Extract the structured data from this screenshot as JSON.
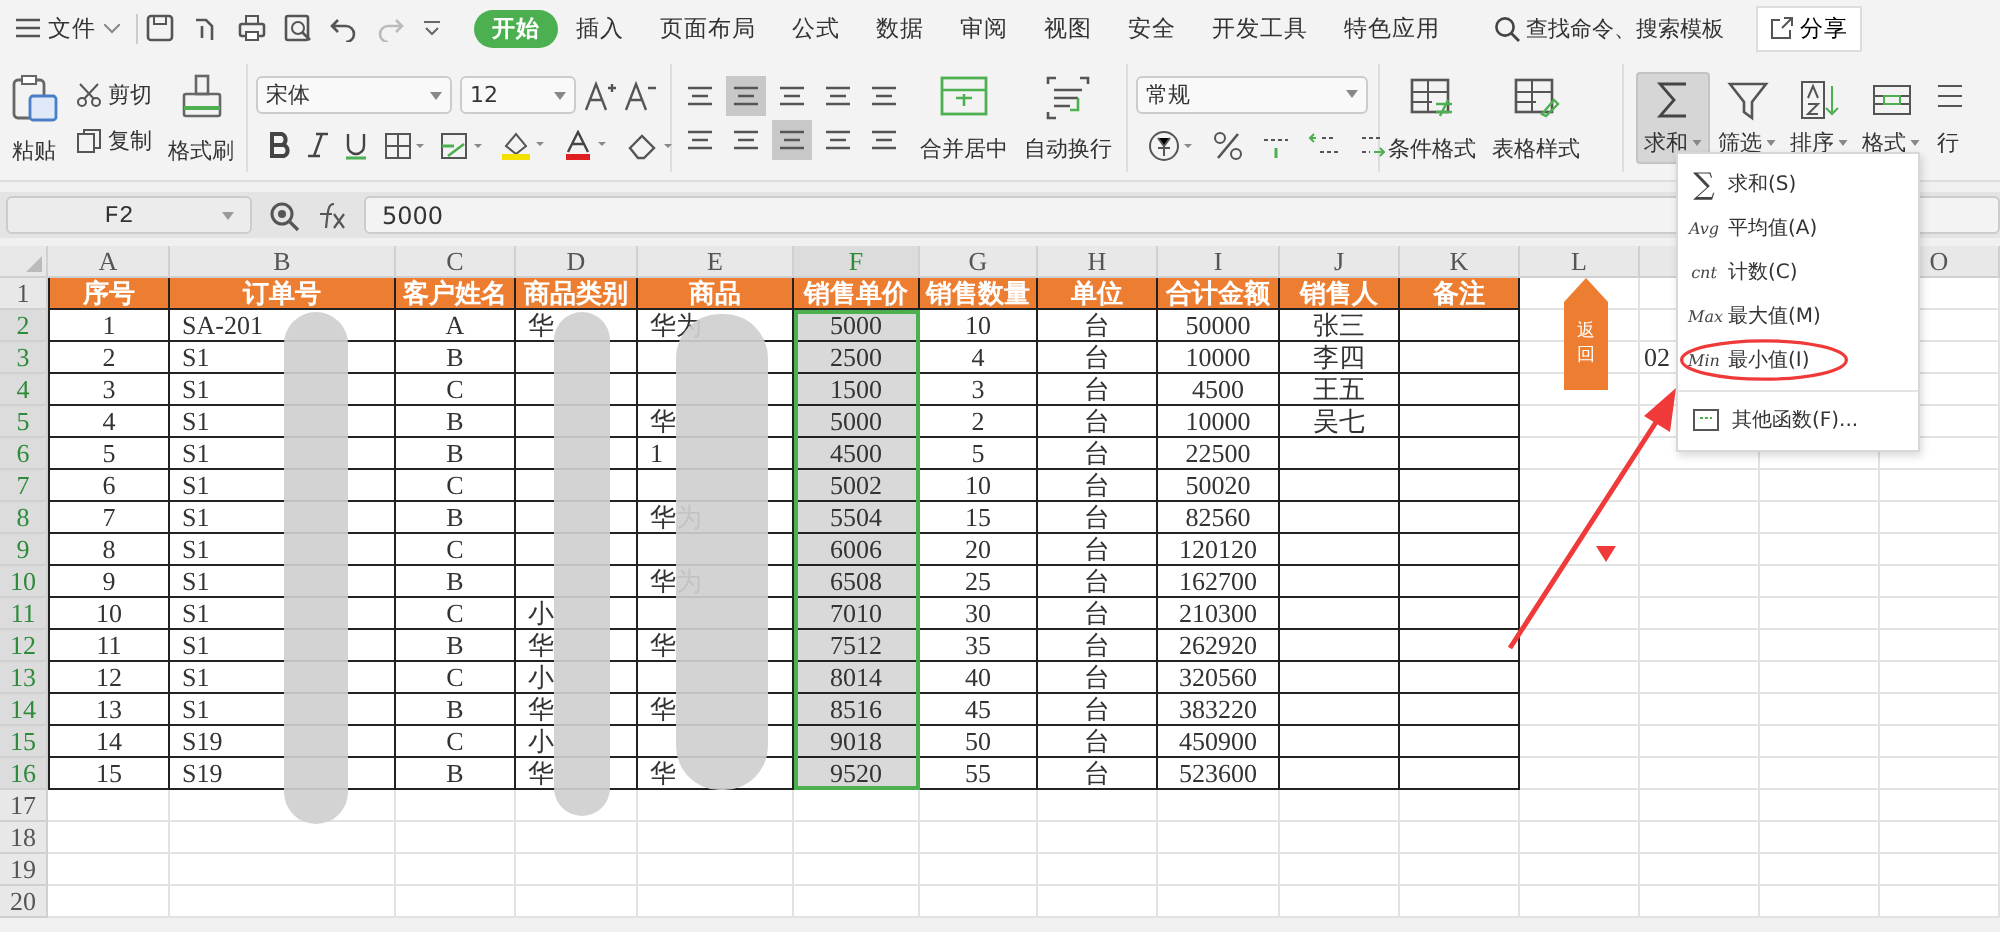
{
  "menu_bar": {
    "file_label": "文件",
    "tabs": [
      {
        "label": "开始",
        "selected": true
      },
      {
        "label": "插入",
        "selected": false
      },
      {
        "label": "页面布局",
        "selected": false
      },
      {
        "label": "公式",
        "selected": false
      },
      {
        "label": "数据",
        "selected": false
      },
      {
        "label": "审阅",
        "selected": false
      },
      {
        "label": "视图",
        "selected": false
      },
      {
        "label": "安全",
        "selected": false
      },
      {
        "label": "开发工具",
        "selected": false
      },
      {
        "label": "特色应用",
        "selected": false
      }
    ],
    "search_placeholder": "查找命令、搜索模板",
    "share_label": "分享"
  },
  "ribbon": {
    "paste": "粘贴",
    "cut": "剪切",
    "copy": "复制",
    "format_painter": "格式刷",
    "font_family": "宋体",
    "font_size": "12",
    "merge": "合并居中",
    "wrap": "自动换行",
    "number_format": "常规",
    "conditional_format": "条件格式",
    "table_style": "表格样式",
    "tools": [
      {
        "label": "求和",
        "pressed": true
      },
      {
        "label": "筛选",
        "pressed": false
      },
      {
        "label": "排序",
        "pressed": false
      },
      {
        "label": "格式",
        "pressed": false
      },
      {
        "label": "行",
        "pressed": false
      }
    ]
  },
  "formula_bar": {
    "cell_ref": "F2",
    "value": "5000"
  },
  "sheet": {
    "columns": [
      {
        "label": "A",
        "selected": false
      },
      {
        "label": "B",
        "selected": false
      },
      {
        "label": "C",
        "selected": false
      },
      {
        "label": "D",
        "selected": false
      },
      {
        "label": "E",
        "selected": false
      },
      {
        "label": "F",
        "selected": true
      },
      {
        "label": "G",
        "selected": false
      },
      {
        "label": "H",
        "selected": false
      },
      {
        "label": "I",
        "selected": false
      },
      {
        "label": "J",
        "selected": false
      },
      {
        "label": "K",
        "selected": false
      },
      {
        "label": "L",
        "selected": false
      }
    ],
    "last_column": "O",
    "header_row": {
      "number": "1",
      "cells": [
        "序号",
        "订单号",
        "客户姓名",
        "商品类别",
        "商品",
        "销售单价",
        "销售数量",
        "单位",
        "合计金额",
        "销售人",
        "备注"
      ]
    },
    "rows": [
      {
        "number": "2",
        "selected": true,
        "cells": [
          "1",
          "SA-201",
          "A",
          "华",
          "华为",
          "5000",
          "10",
          "台",
          "50000",
          "张三",
          ""
        ]
      },
      {
        "number": "3",
        "selected": true,
        "cells": [
          "2",
          "S1",
          "B",
          "",
          "",
          "2500",
          "4",
          "台",
          "10000",
          "李四",
          ""
        ]
      },
      {
        "number": "4",
        "selected": true,
        "cells": [
          "3",
          "S1",
          "C",
          "",
          "",
          "1500",
          "3",
          "台",
          "4500",
          "王五",
          ""
        ]
      },
      {
        "number": "5",
        "selected": true,
        "cells": [
          "4",
          "S1",
          "B",
          "",
          "华",
          "5000",
          "2",
          "台",
          "10000",
          "吴七",
          ""
        ]
      },
      {
        "number": "6",
        "selected": true,
        "cells": [
          "5",
          "S1",
          "B",
          "",
          "1",
          "4500",
          "5",
          "台",
          "22500",
          "",
          ""
        ]
      },
      {
        "number": "7",
        "selected": true,
        "cells": [
          "6",
          "S1",
          "C",
          "",
          "",
          "5002",
          "10",
          "台",
          "50020",
          "",
          ""
        ]
      },
      {
        "number": "8",
        "selected": true,
        "cells": [
          "7",
          "S1",
          "B",
          "",
          "华为",
          "5504",
          "15",
          "台",
          "82560",
          "",
          ""
        ]
      },
      {
        "number": "9",
        "selected": true,
        "cells": [
          "8",
          "S1",
          "C",
          "",
          "",
          "6006",
          "20",
          "台",
          "120120",
          "",
          ""
        ]
      },
      {
        "number": "10",
        "selected": true,
        "cells": [
          "9",
          "S1",
          "B",
          "",
          "华为",
          "6508",
          "25",
          "台",
          "162700",
          "",
          ""
        ]
      },
      {
        "number": "11",
        "selected": true,
        "cells": [
          "10",
          "S1",
          "C",
          "小",
          "",
          "7010",
          "30",
          "台",
          "210300",
          "",
          ""
        ]
      },
      {
        "number": "12",
        "selected": true,
        "cells": [
          "11",
          "S1",
          "B",
          "华",
          "华",
          "7512",
          "35",
          "台",
          "262920",
          "",
          ""
        ]
      },
      {
        "number": "13",
        "selected": true,
        "cells": [
          "12",
          "S1",
          "C",
          "小",
          "",
          "8014",
          "40",
          "台",
          "320560",
          "",
          ""
        ]
      },
      {
        "number": "14",
        "selected": true,
        "cells": [
          "13",
          "S1",
          "B",
          "华",
          "华",
          "8516",
          "45",
          "台",
          "383220",
          "",
          ""
        ]
      },
      {
        "number": "15",
        "selected": true,
        "cells": [
          "14",
          "S19",
          "C",
          "小",
          "",
          "9018",
          "50",
          "台",
          "450900",
          "",
          ""
        ]
      },
      {
        "number": "16",
        "selected": true,
        "cells": [
          "15",
          "S19",
          "B",
          "华",
          "华",
          "9520",
          "55",
          "台",
          "523600",
          "",
          ""
        ]
      }
    ],
    "empty_rows": [
      "17",
      "18",
      "19",
      "20"
    ],
    "return_button": "返回",
    "stray_text": "02"
  },
  "sum_menu": [
    {
      "glyph": "∑",
      "label": "求和(S)",
      "annotated": false,
      "separator_before": false
    },
    {
      "glyph": "Avg",
      "label": "平均值(A)",
      "annotated": false,
      "separator_before": false
    },
    {
      "glyph": "cnt",
      "label": "计数(C)",
      "annotated": false,
      "separator_before": false
    },
    {
      "glyph": "Max",
      "label": "最大值(M)",
      "annotated": false,
      "separator_before": false
    },
    {
      "glyph": "Min",
      "label": "最小值(I)",
      "annotated": true,
      "separator_before": false
    },
    {
      "label": "其他函数(F)...",
      "annotated": false,
      "separator_before": true
    }
  ]
}
